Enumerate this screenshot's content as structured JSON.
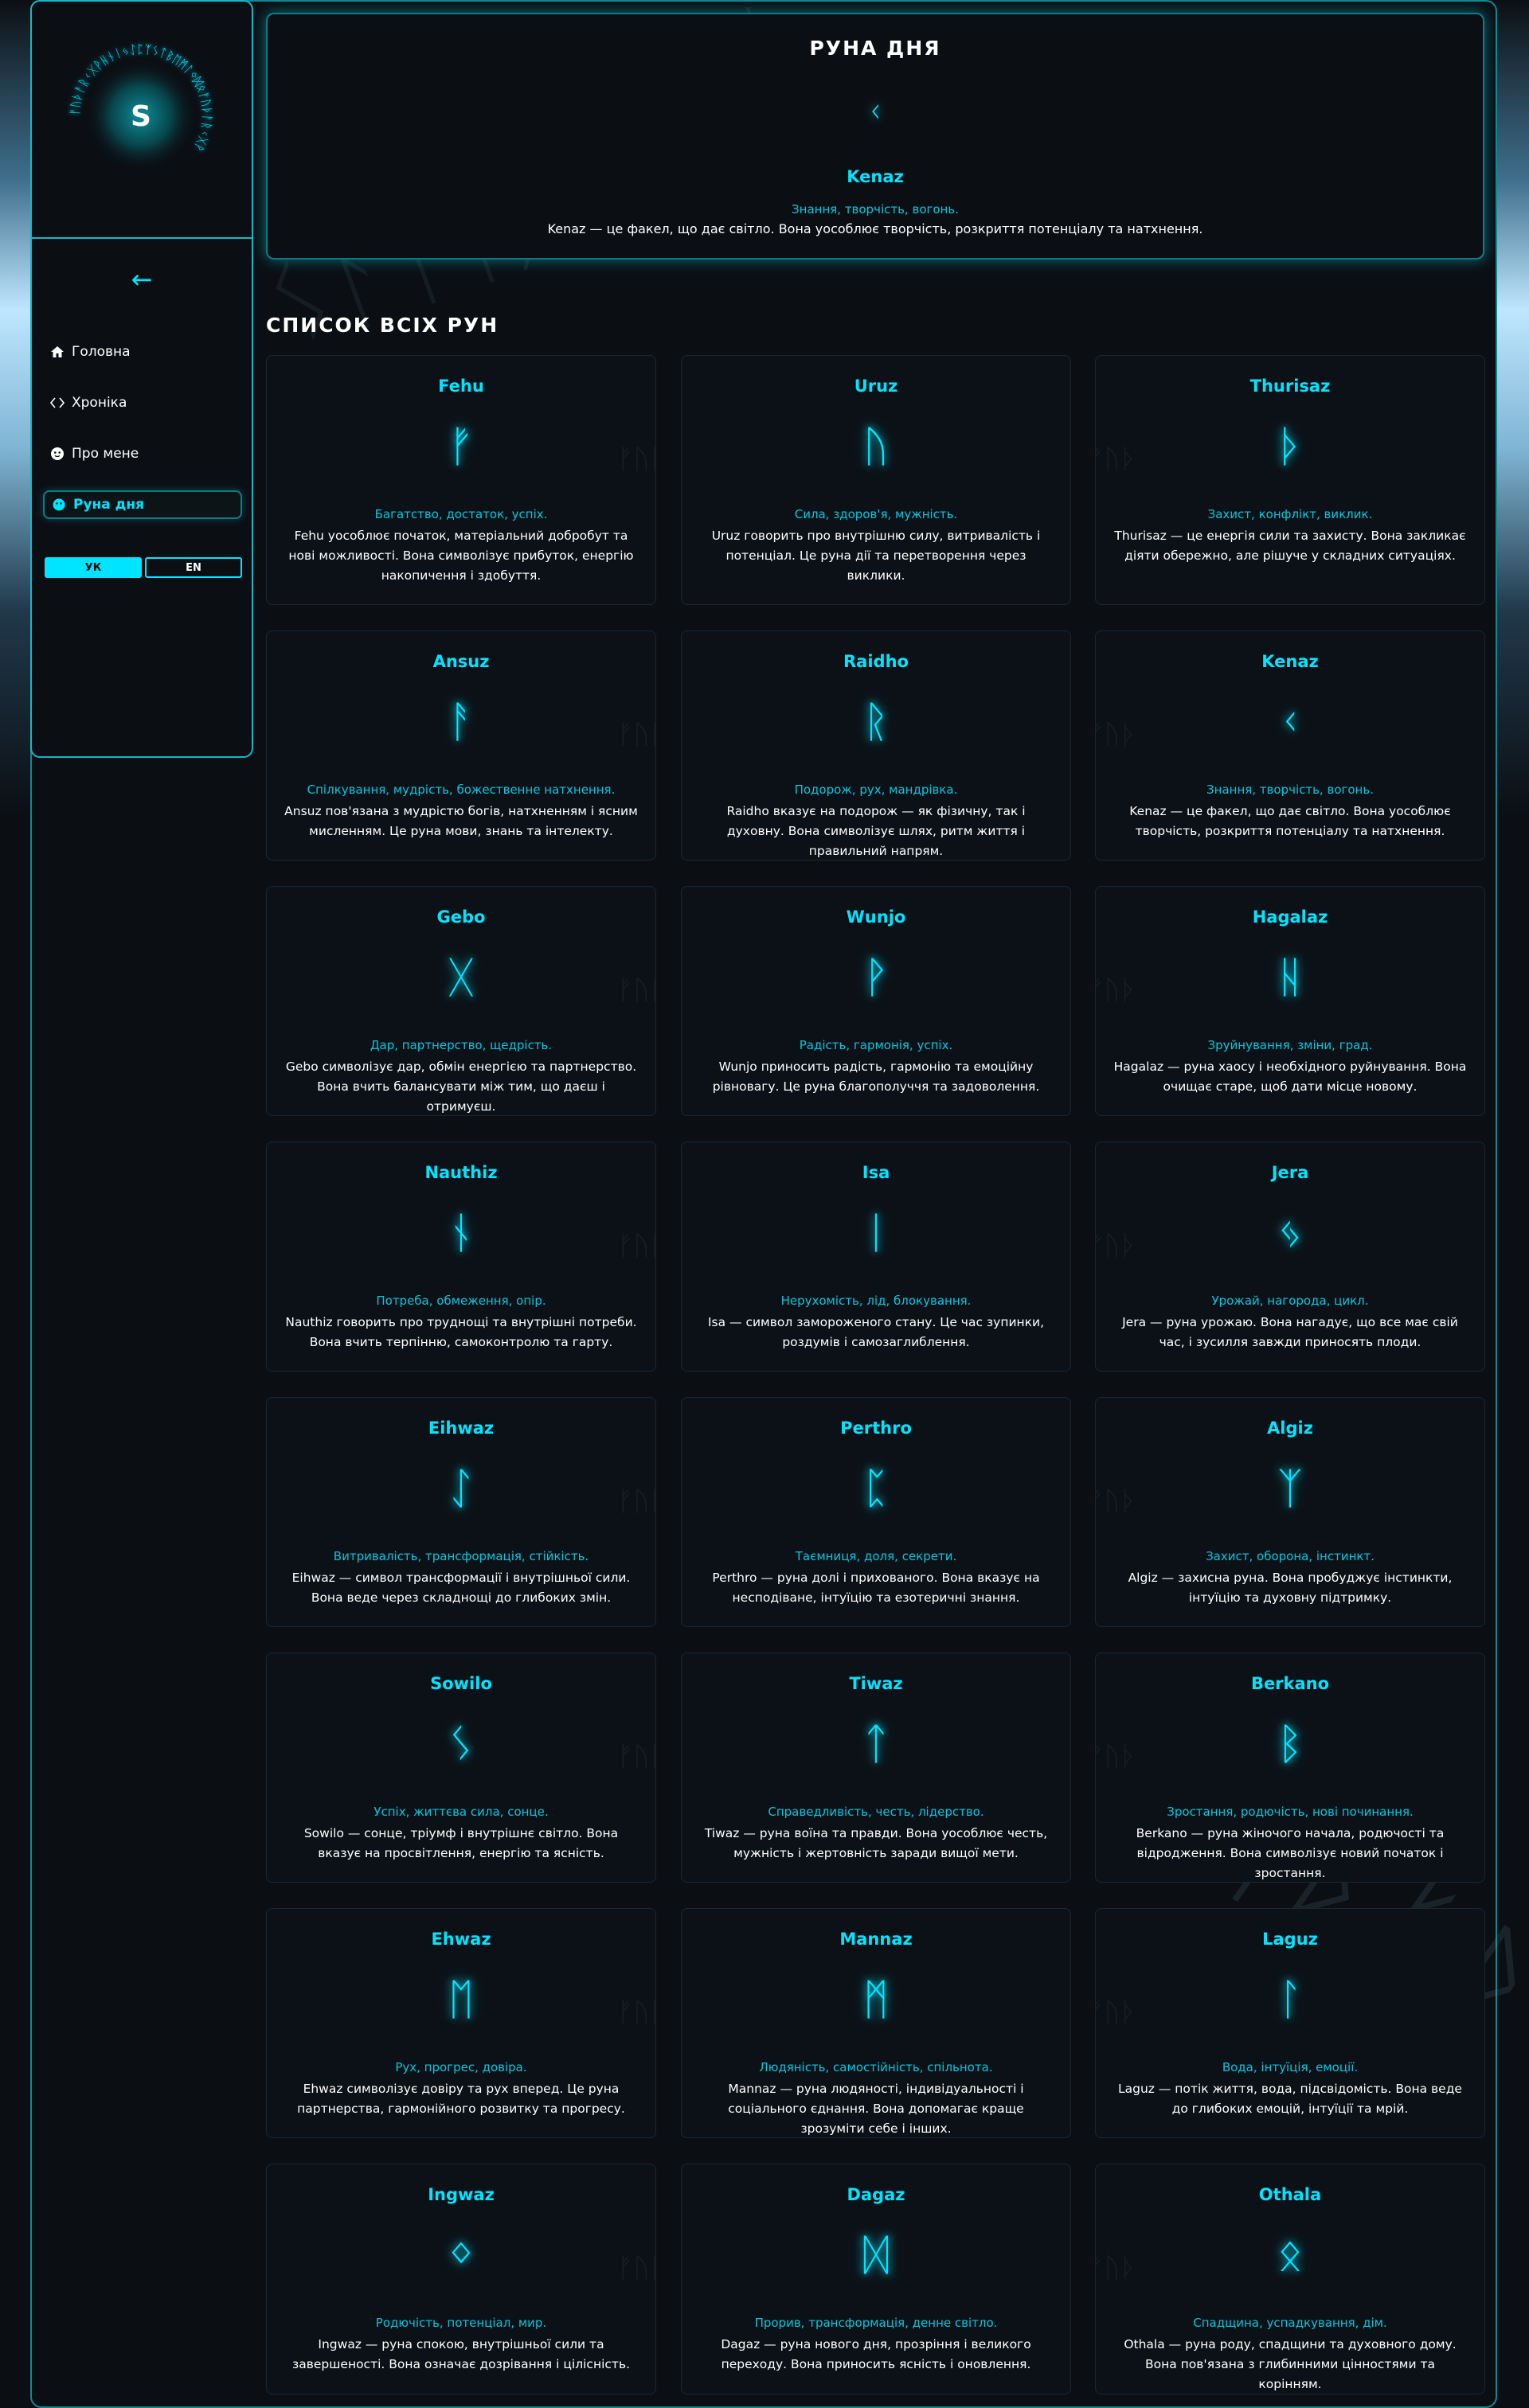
{
  "sidebar": {
    "logo_letter": "S",
    "logo_runes": "ᚠᚢᚦᚨᚱᚲᚷᚹᚺᚾᛁᛃᛇᛈᛉᛊᛏᛒᛖᛗᛚᛜᛞᛟᚠᚢᚦᚨᚱᚲᚷᚹ",
    "back_arrow": "←",
    "nav": [
      {
        "label": "Головна",
        "icon": "home-icon"
      },
      {
        "label": "Хроніка",
        "icon": "code-brackets-icon"
      },
      {
        "label": "Про мене",
        "icon": "face-icon"
      },
      {
        "label": "Руна дня",
        "icon": "circle-icon"
      }
    ],
    "lang_uk": "УК",
    "lang_en": "EN"
  },
  "rune_of_day": {
    "title": "РУНА ДНЯ",
    "glyph": "ᚲ",
    "name": "Kenaz",
    "keywords": "Знання, творчість, вогонь.",
    "description": "Kenaz — це факел, що дає світло. Вона уособлює творчість, розкриття потенціалу та натхнення."
  },
  "section_title": "СПИСОК ВСІХ РУН",
  "runes": [
    {
      "name": "Fehu",
      "glyph": "ᚠ",
      "keywords": "Багатство, достаток, успіх.",
      "description": "Fehu уособлює початок, матеріальний добробут та нові можливості. Вона символізує прибуток, енергію накопичення і здобуття."
    },
    {
      "name": "Uruz",
      "glyph": "ᚢ",
      "keywords": "Сила, здоров'я, мужність.",
      "description": "Uruz говорить про внутрішню силу, витривалість і потенціал. Це руна дії та перетворення через виклики."
    },
    {
      "name": "Thurisaz",
      "glyph": "ᚦ",
      "keywords": "Захист, конфлікт, виклик.",
      "description": "Thurisaz — це енергія сили та захисту. Вона закликає діяти обережно, але рішуче у складних ситуаціях."
    },
    {
      "name": "Ansuz",
      "glyph": "ᚨ",
      "keywords": "Спілкування, мудрість, божественне натхнення.",
      "description": "Ansuz пов'язана з мудрістю богів, натхненням і ясним мисленням. Це руна мови, знань та інтелекту."
    },
    {
      "name": "Raidho",
      "glyph": "ᚱ",
      "keywords": "Подорож, рух, мандрівка.",
      "description": "Raidho вказує на подорож — як фізичну, так і духовну. Вона символізує шлях, ритм життя і правильний напрям."
    },
    {
      "name": "Kenaz",
      "glyph": "ᚲ",
      "keywords": "Знання, творчість, вогонь.",
      "description": "Kenaz — це факел, що дає світло. Вона уособлює творчість, розкриття потенціалу та натхнення."
    },
    {
      "name": "Gebo",
      "glyph": "ᚷ",
      "keywords": "Дар, партнерство, щедрість.",
      "description": "Gebo символізує дар, обмін енергією та партнерство. Вона вчить балансувати між тим, що даєш і отримуєш."
    },
    {
      "name": "Wunjo",
      "glyph": "ᚹ",
      "keywords": "Радість, гармонія, успіх.",
      "description": "Wunjo приносить радість, гармонію та емоційну рівновагу. Це руна благополуччя та задоволення."
    },
    {
      "name": "Hagalaz",
      "glyph": "ᚺ",
      "keywords": "Зруйнування, зміни, град.",
      "description": "Hagalaz — руна хаосу і необхідного руйнування. Вона очищає старе, щоб дати місце новому."
    },
    {
      "name": "Nauthiz",
      "glyph": "ᚾ",
      "keywords": "Потреба, обмеження, опір.",
      "description": "Nauthiz говорить про труднощі та внутрішні потреби. Вона вчить терпінню, самоконтролю та гарту."
    },
    {
      "name": "Isa",
      "glyph": "ᛁ",
      "keywords": "Нерухомість, лід, блокування.",
      "description": "Isa — символ замороженого стану. Це час зупинки, роздумів і самозаглиблення."
    },
    {
      "name": "Jera",
      "glyph": "ᛃ",
      "keywords": "Урожай, нагорода, цикл.",
      "description": "Jera — руна урожаю. Вона нагадує, що все має свій час, і зусилля завжди приносять плоди."
    },
    {
      "name": "Eihwaz",
      "glyph": "ᛇ",
      "keywords": "Витривалість, трансформація, стійкість.",
      "description": "Eihwaz — символ трансформації і внутрішньої сили. Вона веде через складнощі до глибоких змін."
    },
    {
      "name": "Perthro",
      "glyph": "ᛈ",
      "keywords": "Таємниця, доля, секрети.",
      "description": "Perthro — руна долі і прихованого. Вона вказує на несподіване, інтуїцію та езотеричні знання."
    },
    {
      "name": "Algiz",
      "glyph": "ᛉ",
      "keywords": "Захист, оборона, інстинкт.",
      "description": "Algiz — захисна руна. Вона пробуджує інстинкти, інтуїцію та духовну підтримку."
    },
    {
      "name": "Sowilo",
      "glyph": "ᛊ",
      "keywords": "Успіх, життєва сила, сонце.",
      "description": "Sowilo — сонце, тріумф і внутрішнє світло. Вона вказує на просвітлення, енергію та ясність."
    },
    {
      "name": "Tiwaz",
      "glyph": "ᛏ",
      "keywords": "Справедливість, честь, лідерство.",
      "description": "Tiwaz — руна воїна та правди. Вона уособлює честь, мужність і жертовність заради вищої мети."
    },
    {
      "name": "Berkano",
      "glyph": "ᛒ",
      "keywords": "Зростання, родючість, нові починання.",
      "description": "Berkano — руна жіночого начала, родючості та відродження. Вона символізує новий початок і зростання."
    },
    {
      "name": "Ehwaz",
      "glyph": "ᛖ",
      "keywords": "Рух, прогрес, довіра.",
      "description": "Ehwaz символізує довіру та рух вперед. Це руна партнерства, гармонійного розвитку та прогресу."
    },
    {
      "name": "Mannaz",
      "glyph": "ᛗ",
      "keywords": "Людяність, самостійність, спільнота.",
      "description": "Mannaz — руна людяності, індивідуальності і соціального єднання. Вона допомагає краще зрозуміти себе і інших."
    },
    {
      "name": "Laguz",
      "glyph": "ᛚ",
      "keywords": "Вода, інтуїція, емоції.",
      "description": "Laguz — потік життя, вода, підсвідомість. Вона веде до глибоких емоцій, інтуїції та мрій."
    },
    {
      "name": "Ingwaz",
      "glyph": "ᛜ",
      "keywords": "Родючість, потенціал, мир.",
      "description": "Ingwaz — руна спокою, внутрішньої сили та завершеності. Вона означає дозрівання і цілісність."
    },
    {
      "name": "Dagaz",
      "glyph": "ᛞ",
      "keywords": "Прорив, трансформація, денне світло.",
      "description": "Dagaz — руна нового дня, прозріння і великого переходу. Вона приносить ясність і оновлення."
    },
    {
      "name": "Othala",
      "glyph": "ᛟ",
      "keywords": "Спадщина, успадкування, дім.",
      "description": "Othala — руна роду, спадщини та духовного дому. Вона пов'язана з глибинними цінностями та корінням."
    }
  ]
}
